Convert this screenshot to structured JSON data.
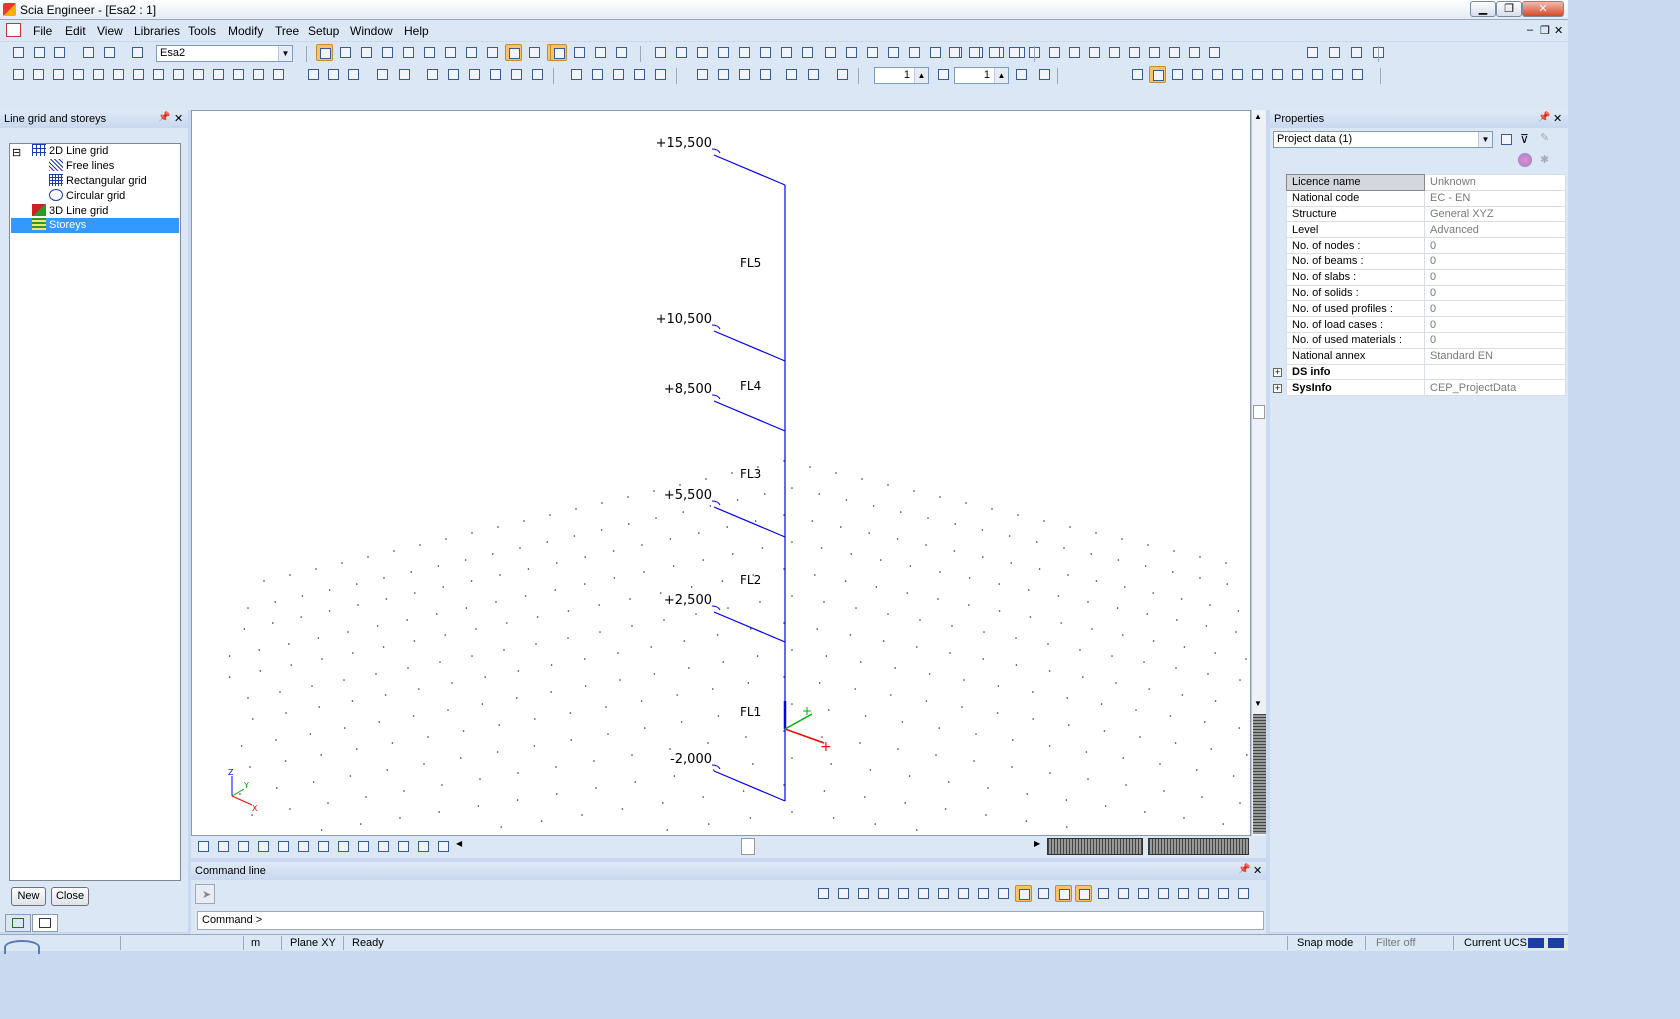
{
  "window": {
    "title": "Scia Engineer - [Esa2 : 1]",
    "minimize": "▁",
    "maximize": "❐",
    "close": "✕"
  },
  "menu": [
    "File",
    "Edit",
    "View",
    "Libraries",
    "Tools",
    "Modify",
    "Tree",
    "Setup",
    "Window",
    "Help"
  ],
  "toolbar": {
    "project_combo": "Esa2",
    "spin1": "1",
    "spin2": "1"
  },
  "left_panel": {
    "title": "Line grid and storeys",
    "tree": [
      {
        "label": "2D Line grid"
      },
      {
        "label": "Free lines"
      },
      {
        "label": "Rectangular grid"
      },
      {
        "label": "Circular grid"
      },
      {
        "label": "3D Line grid"
      },
      {
        "label": "Storeys"
      }
    ],
    "new_button": "New",
    "close_button": "Close"
  },
  "viewport": {
    "levels": [
      {
        "label": "+15,500"
      },
      {
        "label": "+10,500"
      },
      {
        "label": "+8,500"
      },
      {
        "label": "+5,500"
      },
      {
        "label": "+2,500"
      },
      {
        "label": "-2,000"
      }
    ],
    "storeys": [
      "FL5",
      "FL4",
      "FL3",
      "FL2",
      "FL1"
    ],
    "axis_labels": {
      "x": "X",
      "y": "Y",
      "z": "Z"
    },
    "colors": {
      "structure": "#0000ff",
      "x_axis": "#ff0000",
      "y_axis": "#00b000"
    }
  },
  "command_line": {
    "title": "Command line",
    "prompt": "Command >"
  },
  "properties": {
    "title": "Properties",
    "selector": "Project data (1)",
    "rows": [
      {
        "key": "Licence name",
        "value": "Unknown"
      },
      {
        "key": "National code",
        "value": "EC - EN"
      },
      {
        "key": "Structure",
        "value": "General XYZ"
      },
      {
        "key": "Level",
        "value": "Advanced"
      },
      {
        "key": "No. of nodes :",
        "value": "0"
      },
      {
        "key": "No. of beams :",
        "value": "0"
      },
      {
        "key": "No. of slabs :",
        "value": "0"
      },
      {
        "key": "No. of solids :",
        "value": "0"
      },
      {
        "key": "No. of used profiles :",
        "value": "0"
      },
      {
        "key": "No. of load cases :",
        "value": "0"
      },
      {
        "key": "No. of used materials :",
        "value": "0"
      },
      {
        "key": "National annex",
        "value": "Standard EN"
      },
      {
        "key": "DS info",
        "value": ""
      },
      {
        "key": "SysInfo",
        "value": "CEP_ProjectData"
      }
    ]
  },
  "status": {
    "units": "m",
    "plane": "Plane XY",
    "state": "Ready",
    "snap": "Snap mode",
    "filter": "Filter off",
    "ucs": "Current UCS"
  }
}
